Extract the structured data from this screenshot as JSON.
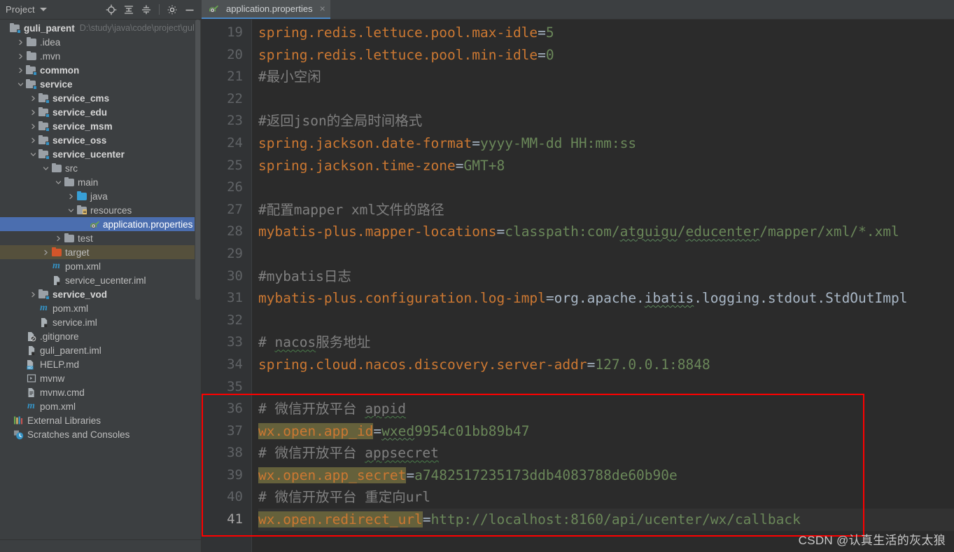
{
  "window": {
    "tool_window_title": "Project",
    "tab_label": "application.properties",
    "tab_close": "×"
  },
  "toolbar": {
    "locate_icon": "locate-icon",
    "expand_icon": "expand-all-icon",
    "collapse_icon": "collapse-all-icon",
    "settings_icon": "gear-icon",
    "hide_icon": "minimize-icon"
  },
  "project_tree": {
    "root": {
      "label": "guli_parent",
      "path": "D:\\study\\java\\code\\project\\guli_p"
    },
    "items": [
      {
        "label": ".idea",
        "indent": 1,
        "arrow": "right",
        "icon": "folder",
        "bold": false
      },
      {
        "label": ".mvn",
        "indent": 1,
        "arrow": "right",
        "icon": "folder",
        "bold": false
      },
      {
        "label": "common",
        "indent": 1,
        "arrow": "right",
        "icon": "module",
        "bold": true
      },
      {
        "label": "service",
        "indent": 1,
        "arrow": "down",
        "icon": "module",
        "bold": true
      },
      {
        "label": "service_cms",
        "indent": 2,
        "arrow": "right",
        "icon": "module",
        "bold": true
      },
      {
        "label": "service_edu",
        "indent": 2,
        "arrow": "right",
        "icon": "module",
        "bold": true
      },
      {
        "label": "service_msm",
        "indent": 2,
        "arrow": "right",
        "icon": "module",
        "bold": true
      },
      {
        "label": "service_oss",
        "indent": 2,
        "arrow": "right",
        "icon": "module",
        "bold": true
      },
      {
        "label": "service_ucenter",
        "indent": 2,
        "arrow": "down",
        "icon": "module",
        "bold": true
      },
      {
        "label": "src",
        "indent": 3,
        "arrow": "down",
        "icon": "folder",
        "bold": false
      },
      {
        "label": "main",
        "indent": 4,
        "arrow": "down",
        "icon": "folder",
        "bold": false
      },
      {
        "label": "java",
        "indent": 5,
        "arrow": "right",
        "icon": "source-folder",
        "bold": false
      },
      {
        "label": "resources",
        "indent": 5,
        "arrow": "down",
        "icon": "resource-folder",
        "bold": false
      },
      {
        "label": "application.properties",
        "indent": 6,
        "arrow": "none",
        "icon": "properties",
        "bold": false,
        "selected": true
      },
      {
        "label": "test",
        "indent": 4,
        "arrow": "right",
        "icon": "folder",
        "bold": false
      },
      {
        "label": "target",
        "indent": 3,
        "arrow": "right",
        "icon": "target-folder",
        "bold": false,
        "highlight": true
      },
      {
        "label": "pom.xml",
        "indent": 3,
        "arrow": "none",
        "icon": "maven",
        "bold": false
      },
      {
        "label": "service_ucenter.iml",
        "indent": 3,
        "arrow": "none",
        "icon": "iml",
        "bold": false
      },
      {
        "label": "service_vod",
        "indent": 2,
        "arrow": "right",
        "icon": "module",
        "bold": true
      },
      {
        "label": "pom.xml",
        "indent": 2,
        "arrow": "none",
        "icon": "maven",
        "bold": false
      },
      {
        "label": "service.iml",
        "indent": 2,
        "arrow": "none",
        "icon": "iml",
        "bold": false
      },
      {
        "label": ".gitignore",
        "indent": 1,
        "arrow": "none",
        "icon": "gitignore",
        "bold": false
      },
      {
        "label": "guli_parent.iml",
        "indent": 1,
        "arrow": "none",
        "icon": "iml",
        "bold": false
      },
      {
        "label": "HELP.md",
        "indent": 1,
        "arrow": "none",
        "icon": "markdown",
        "bold": false
      },
      {
        "label": "mvnw",
        "indent": 1,
        "arrow": "none",
        "icon": "script",
        "bold": false
      },
      {
        "label": "mvnw.cmd",
        "indent": 1,
        "arrow": "none",
        "icon": "cmd",
        "bold": false
      },
      {
        "label": "pom.xml",
        "indent": 1,
        "arrow": "none",
        "icon": "maven",
        "bold": false
      },
      {
        "label": "External Libraries",
        "indent": 0,
        "arrow": "none",
        "icon": "libraries",
        "bold": false
      },
      {
        "label": "Scratches and Consoles",
        "indent": 0,
        "arrow": "none",
        "icon": "scratches",
        "bold": false
      }
    ]
  },
  "editor": {
    "first_line_number": 19,
    "current_line_number": 41,
    "line_numbers": [
      19,
      20,
      21,
      22,
      23,
      24,
      25,
      26,
      27,
      28,
      29,
      30,
      31,
      32,
      33,
      34,
      35,
      36,
      37,
      38,
      39,
      40,
      41
    ],
    "lines": [
      {
        "n": 19,
        "type": "kv",
        "key": "spring.redis.lettuce.pool.max-idle",
        "value": "5"
      },
      {
        "n": 20,
        "type": "kv",
        "key": "spring.redis.lettuce.pool.min-idle",
        "value": "0"
      },
      {
        "n": 21,
        "type": "comment",
        "text": "#最小空闲"
      },
      {
        "n": 22,
        "type": "blank",
        "text": ""
      },
      {
        "n": 23,
        "type": "comment",
        "text": "#返回json的全局时间格式"
      },
      {
        "n": 24,
        "type": "kv",
        "key": "spring.jackson.date-format",
        "value": "yyyy-MM-dd HH:mm:ss"
      },
      {
        "n": 25,
        "type": "kv",
        "key": "spring.jackson.time-zone",
        "value": "GMT+8"
      },
      {
        "n": 26,
        "type": "blank",
        "text": ""
      },
      {
        "n": 27,
        "type": "comment",
        "text": "#配置mapper xml文件的路径"
      },
      {
        "n": 28,
        "type": "kv",
        "key": "mybatis-plus.mapper-locations",
        "value": "classpath:com/atguigu/educenter/mapper/xml/*.xml"
      },
      {
        "n": 29,
        "type": "blank",
        "text": ""
      },
      {
        "n": 30,
        "type": "comment",
        "text": "#mybatis日志"
      },
      {
        "n": 31,
        "type": "kv-cls",
        "key": "mybatis-plus.configuration.log-impl",
        "value": "org.apache.ibatis.logging.stdout.StdOutImpl"
      },
      {
        "n": 32,
        "type": "blank",
        "text": ""
      },
      {
        "n": 33,
        "type": "comment",
        "text": "# nacos服务地址"
      },
      {
        "n": 34,
        "type": "kv",
        "key": "spring.cloud.nacos.discovery.server-addr",
        "value": "127.0.0.1:8848"
      },
      {
        "n": 35,
        "type": "blank",
        "text": ""
      },
      {
        "n": 36,
        "type": "comment",
        "text": "# 微信开放平台 appid"
      },
      {
        "n": 37,
        "type": "kv-hl",
        "key": "wx.open.app_id",
        "value": "wxed9954c01bb89b47"
      },
      {
        "n": 38,
        "type": "comment",
        "text": "# 微信开放平台 appsecret"
      },
      {
        "n": 39,
        "type": "kv-hl",
        "key": "wx.open.app_secret",
        "value": "a7482517235173ddb4083788de60b90e"
      },
      {
        "n": 40,
        "type": "comment",
        "text": "# 微信开放平台 重定向url"
      },
      {
        "n": 41,
        "type": "kv-hl",
        "key": "wx.open.redirect_url",
        "value": "http://localhost:8160/api/ucenter/wx/callback",
        "current": true
      }
    ]
  },
  "annotation": {
    "box_color": "#ff0000",
    "watermark": "CSDN @认真生活的灰太狼"
  },
  "colors": {
    "key": "#cc7832",
    "value": "#6a8759",
    "comment": "#808080",
    "key_highlight_bg": "#65613b",
    "editor_bg": "#2b2b2b",
    "gutter_bg": "#313335",
    "panel_bg": "#3c3f41",
    "selection_bg": "#4b6eaf",
    "accent": "#4a88c7"
  }
}
